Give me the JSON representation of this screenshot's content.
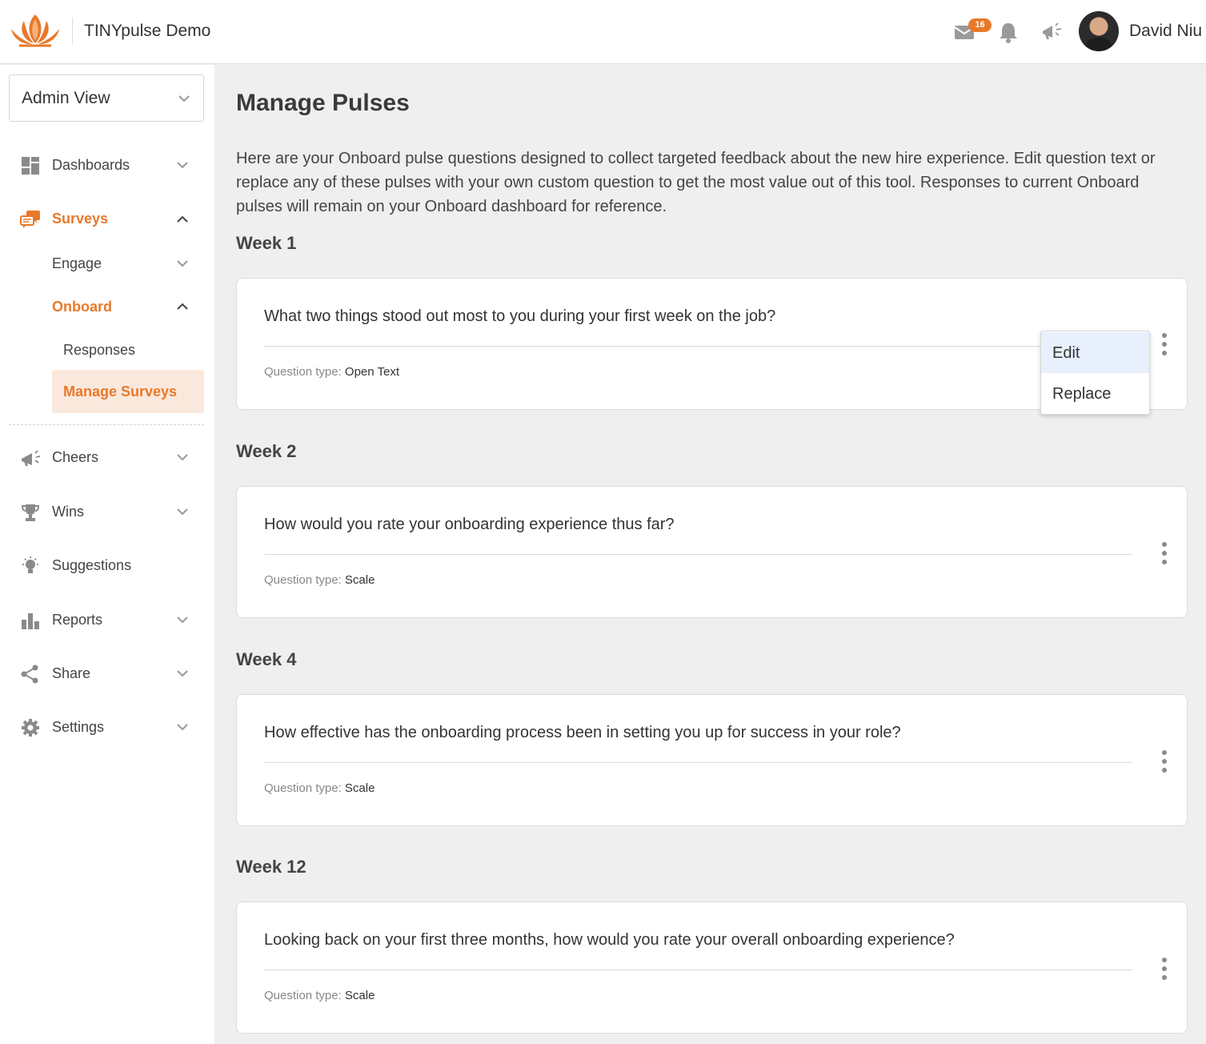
{
  "header": {
    "brand": "TINYpulse Demo",
    "inbox_badge": "16",
    "user_name": "David Niu"
  },
  "colors": {
    "accent": "#e8792b",
    "active_bg": "#fbe8dc",
    "menu_highlight": "#e8f0fe"
  },
  "sidebar": {
    "view_select": "Admin View",
    "items": [
      {
        "label": "Dashboards",
        "icon": "dashboard-icon"
      },
      {
        "label": "Surveys",
        "icon": "surveys-icon",
        "active": true
      },
      {
        "label": "Cheers",
        "icon": "cheers-icon"
      },
      {
        "label": "Wins",
        "icon": "trophy-icon"
      },
      {
        "label": "Suggestions",
        "icon": "lightbulb-icon"
      },
      {
        "label": "Reports",
        "icon": "bar-chart-icon"
      },
      {
        "label": "Share",
        "icon": "share-icon"
      },
      {
        "label": "Settings",
        "icon": "gear-icon"
      }
    ],
    "surveys_sub": {
      "engage": "Engage",
      "onboard": "Onboard",
      "responses": "Responses",
      "manage_surveys": "Manage Surveys"
    }
  },
  "main": {
    "title": "Manage Pulses",
    "intro": "Here are your Onboard pulse questions designed to collect targeted feedback about the new hire experience. Edit question text or replace any of these pulses with your own custom question to get the most value out of this tool. Responses to current Onboard pulses will remain on your Onboard dashboard for reference.",
    "question_type_label": "Question type:",
    "pulses": [
      {
        "week": "Week 1",
        "question": "What two things stood out most to you during your first week on the job?",
        "type": "Open Text"
      },
      {
        "week": "Week 2",
        "question": "How would you rate your onboarding experience thus far?",
        "type": "Scale"
      },
      {
        "week": "Week 4",
        "question": "How effective has the onboarding process been in setting you up for success in your role?",
        "type": "Scale"
      },
      {
        "week": "Week 12",
        "question": "Looking back on your first three months, how would you rate your overall onboarding experience?",
        "type": "Scale"
      }
    ],
    "menu": {
      "edit": "Edit",
      "replace": "Replace"
    }
  }
}
